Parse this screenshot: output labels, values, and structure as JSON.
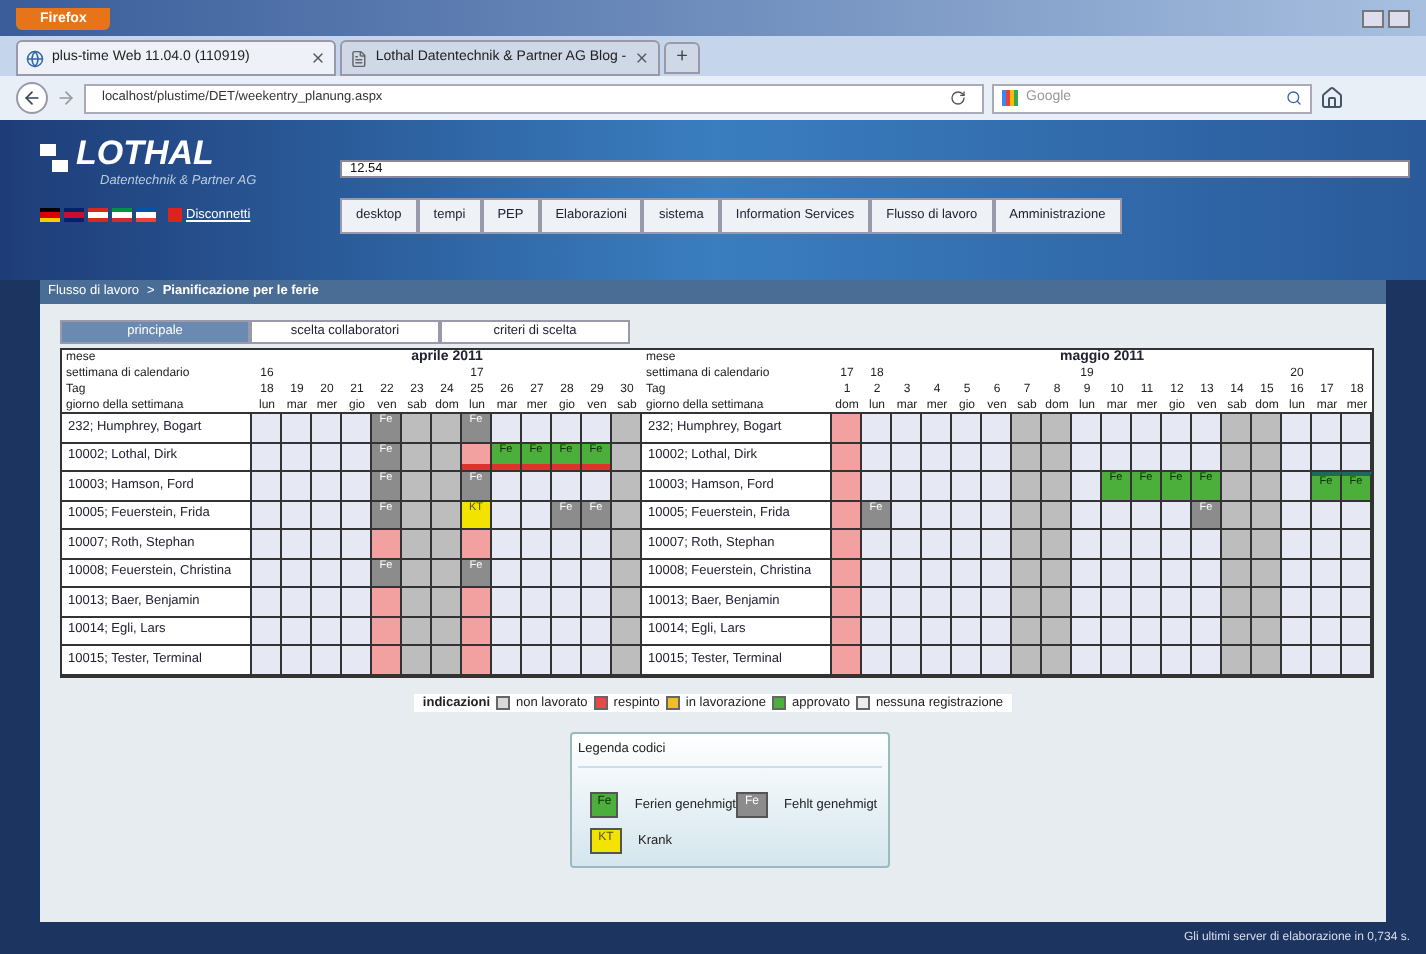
{
  "browser": {
    "menu_button": "Firefox",
    "tabs": [
      {
        "label": "plus-time Web 11.04.0 (110919)",
        "selected": true
      },
      {
        "label": "Lothal Datentechnik & Partner AG Blog -",
        "selected": false
      }
    ],
    "new_tab": "+",
    "url": "localhost/plustime/DET/weekentry_planung.aspx",
    "search_placeholder": "Google"
  },
  "header": {
    "logo": "LOTHAL",
    "logo_subtitle": "Datentechnik & Partner AG",
    "field_value": "12.54",
    "nav": [
      "desktop",
      "tempi",
      "PEP",
      "Elaborazioni",
      "sistema",
      "Information Services",
      "Flusso di lavoro",
      "Amministrazione"
    ],
    "logout": "Disconnetti"
  },
  "breadcrumb": {
    "path": "Flusso di lavoro",
    "separator": ">",
    "current": "Pianificazione per le ferie"
  },
  "tabs": [
    {
      "label": "principale",
      "selected": true
    },
    {
      "label": "scelta collaboratori",
      "selected": false
    },
    {
      "label": "criteri di scelta",
      "selected": false
    }
  ],
  "calendar": {
    "halves": [
      {
        "labels": [
          "mese",
          "settimana di calendario",
          "Tag",
          "giorno della settimana"
        ],
        "month": "aprile 2011",
        "days": [
          {
            "week": "16",
            "date": "18",
            "weekday": "lun",
            "kind": "work"
          },
          {
            "date": "19",
            "weekday": "mar",
            "kind": "work"
          },
          {
            "date": "20",
            "weekday": "mer",
            "kind": "work"
          },
          {
            "date": "21",
            "weekday": "gio",
            "kind": "work"
          },
          {
            "date": "22",
            "weekday": "ven",
            "kind": "holiday"
          },
          {
            "date": "23",
            "weekday": "sab",
            "kind": "weekend"
          },
          {
            "date": "24",
            "weekday": "dom",
            "kind": "weekend"
          },
          {
            "week": "17",
            "date": "25",
            "weekday": "lun",
            "kind": "holiday"
          },
          {
            "date": "26",
            "weekday": "mar",
            "kind": "work"
          },
          {
            "date": "27",
            "weekday": "mer",
            "kind": "work"
          },
          {
            "date": "28",
            "weekday": "gio",
            "kind": "work"
          },
          {
            "date": "29",
            "weekday": "ven",
            "kind": "work"
          },
          {
            "date": "30",
            "weekday": "sab",
            "kind": "weekend"
          }
        ],
        "rows": [
          {
            "name": "232; Humphrey, Bogart",
            "cells": [
              {
                "kind": "none"
              },
              {
                "kind": "none"
              },
              {
                "kind": "none"
              },
              {
                "kind": "none"
              },
              {
                "kind": "absence",
                "label": "Fe"
              },
              {
                "kind": "none"
              },
              {
                "kind": "none"
              },
              {
                "kind": "absence",
                "label": "Fe"
              },
              {
                "kind": "none"
              },
              {
                "kind": "none"
              },
              {
                "kind": "none"
              },
              {
                "kind": "none"
              },
              {
                "kind": "none"
              }
            ]
          },
          {
            "name": "10002; Lothal, Dirk",
            "cells": [
              {
                "kind": "none"
              },
              {
                "kind": "none"
              },
              {
                "kind": "none"
              },
              {
                "kind": "none"
              },
              {
                "kind": "absence",
                "label": "Fe"
              },
              {
                "kind": "none"
              },
              {
                "kind": "none"
              },
              {
                "kind": "none",
                "marked": true
              },
              {
                "kind": "approved",
                "label": "Fe",
                "marked": true
              },
              {
                "kind": "approved",
                "label": "Fe",
                "marked": true
              },
              {
                "kind": "approved",
                "label": "Fe",
                "marked": true
              },
              {
                "kind": "approved",
                "label": "Fe",
                "marked": true
              },
              {
                "kind": "none"
              }
            ]
          },
          {
            "name": "10003; Hamson, Ford",
            "cells": [
              {
                "kind": "none"
              },
              {
                "kind": "none"
              },
              {
                "kind": "none"
              },
              {
                "kind": "none"
              },
              {
                "kind": "absence",
                "label": "Fe"
              },
              {
                "kind": "none"
              },
              {
                "kind": "none"
              },
              {
                "kind": "absence",
                "label": "Fe"
              },
              {
                "kind": "none"
              },
              {
                "kind": "none"
              },
              {
                "kind": "none"
              },
              {
                "kind": "none"
              },
              {
                "kind": "none"
              }
            ]
          },
          {
            "name": "10005; Feuerstein, Frida",
            "cells": [
              {
                "kind": "none"
              },
              {
                "kind": "none"
              },
              {
                "kind": "none"
              },
              {
                "kind": "none"
              },
              {
                "kind": "absence",
                "label": "Fe"
              },
              {
                "kind": "none"
              },
              {
                "kind": "none"
              },
              {
                "kind": "sick",
                "label": "KT"
              },
              {
                "kind": "none"
              },
              {
                "kind": "none"
              },
              {
                "kind": "absence",
                "label": "Fe"
              },
              {
                "kind": "absence",
                "label": "Fe"
              },
              {
                "kind": "none"
              }
            ]
          },
          {
            "name": "10007; Roth, Stephan",
            "cells": [
              {
                "kind": "none"
              },
              {
                "kind": "none"
              },
              {
                "kind": "none"
              },
              {
                "kind": "none"
              },
              {
                "kind": "none"
              },
              {
                "kind": "none"
              },
              {
                "kind": "none"
              },
              {
                "kind": "none"
              },
              {
                "kind": "none"
              },
              {
                "kind": "none"
              },
              {
                "kind": "none"
              },
              {
                "kind": "none"
              },
              {
                "kind": "none"
              }
            ]
          },
          {
            "name": "10008; Feuerstein, Christina",
            "cells": [
              {
                "kind": "none"
              },
              {
                "kind": "none"
              },
              {
                "kind": "none"
              },
              {
                "kind": "none"
              },
              {
                "kind": "absence",
                "label": "Fe"
              },
              {
                "kind": "none"
              },
              {
                "kind": "none"
              },
              {
                "kind": "absence",
                "label": "Fe"
              },
              {
                "kind": "none"
              },
              {
                "kind": "none"
              },
              {
                "kind": "none"
              },
              {
                "kind": "none"
              },
              {
                "kind": "none"
              }
            ]
          },
          {
            "name": "10013; Baer, Benjamin",
            "cells": [
              {
                "kind": "none"
              },
              {
                "kind": "none"
              },
              {
                "kind": "none"
              },
              {
                "kind": "none"
              },
              {
                "kind": "none"
              },
              {
                "kind": "none"
              },
              {
                "kind": "none"
              },
              {
                "kind": "none"
              },
              {
                "kind": "none"
              },
              {
                "kind": "none"
              },
              {
                "kind": "none"
              },
              {
                "kind": "none"
              },
              {
                "kind": "none"
              }
            ]
          },
          {
            "name": "10014; Egli, Lars",
            "cells": [
              {
                "kind": "none"
              },
              {
                "kind": "none"
              },
              {
                "kind": "none"
              },
              {
                "kind": "none"
              },
              {
                "kind": "none"
              },
              {
                "kind": "none"
              },
              {
                "kind": "none"
              },
              {
                "kind": "none"
              },
              {
                "kind": "none"
              },
              {
                "kind": "none"
              },
              {
                "kind": "none"
              },
              {
                "kind": "none"
              },
              {
                "kind": "none"
              }
            ]
          },
          {
            "name": "10015; Tester, Terminal",
            "cells": [
              {
                "kind": "none"
              },
              {
                "kind": "none"
              },
              {
                "kind": "none"
              },
              {
                "kind": "none"
              },
              {
                "kind": "none"
              },
              {
                "kind": "none"
              },
              {
                "kind": "none"
              },
              {
                "kind": "none"
              },
              {
                "kind": "none"
              },
              {
                "kind": "none"
              },
              {
                "kind": "none"
              },
              {
                "kind": "none"
              },
              {
                "kind": "none"
              }
            ]
          }
        ]
      },
      {
        "labels": [
          "mese",
          "settimana di calendario",
          "Tag",
          "giorno della settimana"
        ],
        "month": "maggio 2011",
        "days": [
          {
            "week": "17",
            "date": "1",
            "weekday": "dom",
            "kind": "holiday"
          },
          {
            "week": "18",
            "date": "2",
            "weekday": "lun",
            "kind": "work"
          },
          {
            "date": "3",
            "weekday": "mar",
            "kind": "work"
          },
          {
            "date": "4",
            "weekday": "mer",
            "kind": "work"
          },
          {
            "date": "5",
            "weekday": "gio",
            "kind": "work"
          },
          {
            "date": "6",
            "weekday": "ven",
            "kind": "work"
          },
          {
            "date": "7",
            "weekday": "sab",
            "kind": "weekend"
          },
          {
            "date": "8",
            "weekday": "dom",
            "kind": "weekend"
          },
          {
            "week": "19",
            "date": "9",
            "weekday": "lun",
            "kind": "work"
          },
          {
            "date": "10",
            "weekday": "mar",
            "kind": "work"
          },
          {
            "date": "11",
            "weekday": "mer",
            "kind": "work"
          },
          {
            "date": "12",
            "weekday": "gio",
            "kind": "work"
          },
          {
            "date": "13",
            "weekday": "ven",
            "kind": "work"
          },
          {
            "date": "14",
            "weekday": "sab",
            "kind": "weekend"
          },
          {
            "date": "15",
            "weekday": "dom",
            "kind": "weekend"
          },
          {
            "week": "20",
            "date": "16",
            "weekday": "lun",
            "kind": "work"
          },
          {
            "date": "17",
            "weekday": "mar",
            "kind": "work"
          },
          {
            "date": "18",
            "weekday": "mer",
            "kind": "work"
          }
        ],
        "rows": [
          {
            "name": "232; Humphrey, Bogart",
            "cells": [
              {
                "kind": "none"
              },
              {
                "kind": "none"
              },
              {
                "kind": "none"
              },
              {
                "kind": "none"
              },
              {
                "kind": "none"
              },
              {
                "kind": "none"
              },
              {
                "kind": "none"
              },
              {
                "kind": "none"
              },
              {
                "kind": "none"
              },
              {
                "kind": "none"
              },
              {
                "kind": "none"
              },
              {
                "kind": "none"
              },
              {
                "kind": "none"
              },
              {
                "kind": "none"
              },
              {
                "kind": "none"
              },
              {
                "kind": "none"
              },
              {
                "kind": "none"
              },
              {
                "kind": "none"
              }
            ]
          },
          {
            "name": "10002; Lothal, Dirk",
            "cells": [
              {
                "kind": "none"
              },
              {
                "kind": "none"
              },
              {
                "kind": "none"
              },
              {
                "kind": "none"
              },
              {
                "kind": "none"
              },
              {
                "kind": "none"
              },
              {
                "kind": "none"
              },
              {
                "kind": "none"
              },
              {
                "kind": "none"
              },
              {
                "kind": "none"
              },
              {
                "kind": "none"
              },
              {
                "kind": "none"
              },
              {
                "kind": "none"
              },
              {
                "kind": "none"
              },
              {
                "kind": "none"
              },
              {
                "kind": "none"
              },
              {
                "kind": "none"
              },
              {
                "kind": "none"
              }
            ]
          },
          {
            "name": "10003; Hamson, Ford",
            "cells": [
              {
                "kind": "none"
              },
              {
                "kind": "none"
              },
              {
                "kind": "none"
              },
              {
                "kind": "none"
              },
              {
                "kind": "none"
              },
              {
                "kind": "none"
              },
              {
                "kind": "none"
              },
              {
                "kind": "none"
              },
              {
                "kind": "none"
              },
              {
                "kind": "approved",
                "label": "Fe"
              },
              {
                "kind": "approved",
                "label": "Fe"
              },
              {
                "kind": "approved",
                "label": "Fe"
              },
              {
                "kind": "approved",
                "label": "Fe"
              },
              {
                "kind": "none"
              },
              {
                "kind": "none"
              },
              {
                "kind": "none"
              },
              {
                "kind": "approved",
                "label": "Fe",
                "framed": true
              },
              {
                "kind": "approved",
                "label": "Fe",
                "framed": true
              }
            ]
          },
          {
            "name": "10005; Feuerstein, Frida",
            "cells": [
              {
                "kind": "none"
              },
              {
                "kind": "absence",
                "label": "Fe"
              },
              {
                "kind": "none"
              },
              {
                "kind": "none"
              },
              {
                "kind": "none"
              },
              {
                "kind": "none"
              },
              {
                "kind": "none"
              },
              {
                "kind": "none"
              },
              {
                "kind": "none"
              },
              {
                "kind": "none"
              },
              {
                "kind": "none"
              },
              {
                "kind": "none"
              },
              {
                "kind": "absence",
                "label": "Fe"
              },
              {
                "kind": "none"
              },
              {
                "kind": "none"
              },
              {
                "kind": "none"
              },
              {
                "kind": "none"
              },
              {
                "kind": "none"
              }
            ]
          },
          {
            "name": "10007; Roth, Stephan",
            "cells": [
              {
                "kind": "none"
              },
              {
                "kind": "none"
              },
              {
                "kind": "none"
              },
              {
                "kind": "none"
              },
              {
                "kind": "none"
              },
              {
                "kind": "none"
              },
              {
                "kind": "none"
              },
              {
                "kind": "none"
              },
              {
                "kind": "none"
              },
              {
                "kind": "none"
              },
              {
                "kind": "none"
              },
              {
                "kind": "none"
              },
              {
                "kind": "none"
              },
              {
                "kind": "none"
              },
              {
                "kind": "none"
              },
              {
                "kind": "none"
              },
              {
                "kind": "none"
              },
              {
                "kind": "none"
              }
            ]
          },
          {
            "name": "10008; Feuerstein, Christina",
            "cells": [
              {
                "kind": "none"
              },
              {
                "kind": "none"
              },
              {
                "kind": "none"
              },
              {
                "kind": "none"
              },
              {
                "kind": "none"
              },
              {
                "kind": "none"
              },
              {
                "kind": "none"
              },
              {
                "kind": "none"
              },
              {
                "kind": "none"
              },
              {
                "kind": "none"
              },
              {
                "kind": "none"
              },
              {
                "kind": "none"
              },
              {
                "kind": "none"
              },
              {
                "kind": "none"
              },
              {
                "kind": "none"
              },
              {
                "kind": "none"
              },
              {
                "kind": "none"
              },
              {
                "kind": "none"
              }
            ]
          },
          {
            "name": "10013; Baer, Benjamin",
            "cells": [
              {
                "kind": "none"
              },
              {
                "kind": "none"
              },
              {
                "kind": "none"
              },
              {
                "kind": "none"
              },
              {
                "kind": "none"
              },
              {
                "kind": "none"
              },
              {
                "kind": "none"
              },
              {
                "kind": "none"
              },
              {
                "kind": "none"
              },
              {
                "kind": "none"
              },
              {
                "kind": "none"
              },
              {
                "kind": "none"
              },
              {
                "kind": "none"
              },
              {
                "kind": "none"
              },
              {
                "kind": "none"
              },
              {
                "kind": "none"
              },
              {
                "kind": "none"
              },
              {
                "kind": "none"
              }
            ]
          },
          {
            "name": "10014; Egli, Lars",
            "cells": [
              {
                "kind": "none"
              },
              {
                "kind": "none"
              },
              {
                "kind": "none"
              },
              {
                "kind": "none"
              },
              {
                "kind": "none"
              },
              {
                "kind": "none"
              },
              {
                "kind": "none"
              },
              {
                "kind": "none"
              },
              {
                "kind": "none"
              },
              {
                "kind": "none"
              },
              {
                "kind": "none"
              },
              {
                "kind": "none"
              },
              {
                "kind": "none"
              },
              {
                "kind": "none"
              },
              {
                "kind": "none"
              },
              {
                "kind": "none"
              },
              {
                "kind": "none"
              },
              {
                "kind": "none"
              }
            ]
          },
          {
            "name": "10015; Tester, Terminal",
            "cells": [
              {
                "kind": "none"
              },
              {
                "kind": "none"
              },
              {
                "kind": "none"
              },
              {
                "kind": "none"
              },
              {
                "kind": "none"
              },
              {
                "kind": "none"
              },
              {
                "kind": "none"
              },
              {
                "kind": "none"
              },
              {
                "kind": "none"
              },
              {
                "kind": "none"
              },
              {
                "kind": "none"
              },
              {
                "kind": "none"
              },
              {
                "kind": "none"
              },
              {
                "kind": "none"
              },
              {
                "kind": "none"
              },
              {
                "kind": "none"
              },
              {
                "kind": "none"
              },
              {
                "kind": "none"
              }
            ]
          }
        ]
      }
    ]
  },
  "indicators": {
    "title": "indicazioni",
    "items": [
      {
        "label": "non lavorato",
        "color": "#d9d9d9"
      },
      {
        "label": "respinto",
        "color": "#e84848"
      },
      {
        "label": "in lavorazione",
        "color": "#f0c020"
      },
      {
        "label": "approvato",
        "color": "#4caf3c"
      },
      {
        "label": "nessuna registrazione",
        "color": "#eeeeee"
      }
    ]
  },
  "code_legend": {
    "title": "Legenda codici",
    "items": [
      {
        "code": "Fe",
        "kind": "approved",
        "label": "Ferien genehmigt"
      },
      {
        "code": "Fe",
        "kind": "absence",
        "label": "Fehlt genehmigt"
      },
      {
        "code": "KT",
        "kind": "sick",
        "label": "Krank"
      }
    ]
  },
  "footer": "Gli ultimi server di elaborazione in 0,734 s."
}
